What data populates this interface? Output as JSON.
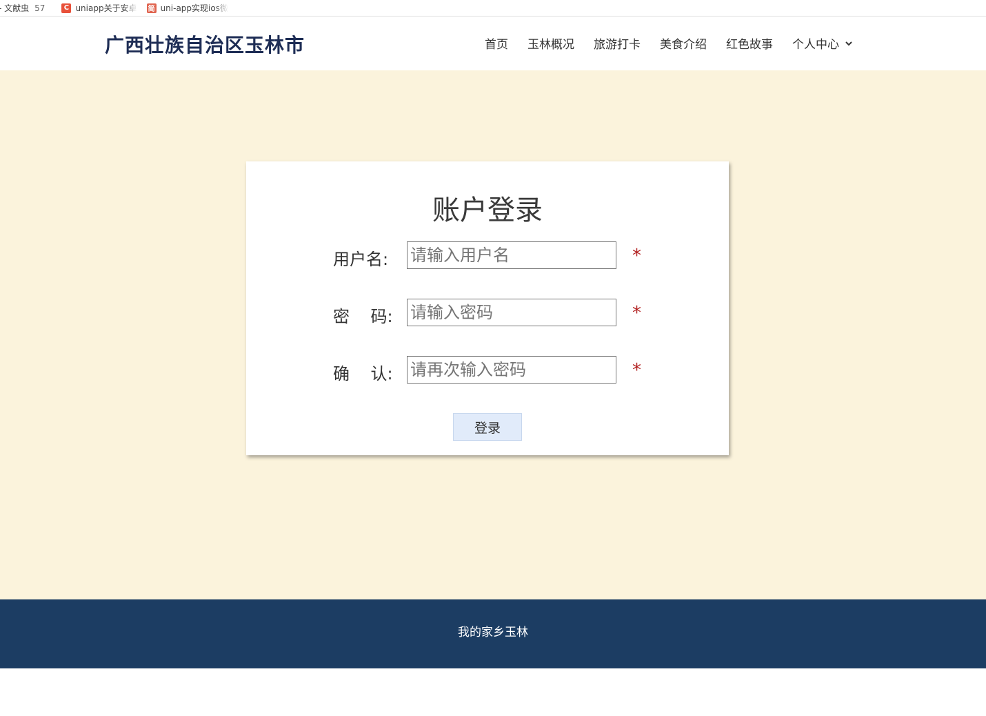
{
  "bookmarks": [
    {
      "label": "- 文献虫",
      "count": "57",
      "icon": "none"
    },
    {
      "label": "uniapp关于安卓",
      "icon": "c-logo-icon",
      "color": "#e8513a"
    },
    {
      "label": "uni-app实现ios微",
      "icon": "jian-logo-icon",
      "color": "#e0644f",
      "glyph": "简"
    }
  ],
  "header": {
    "site_title": "广西壮族自治区玉林市",
    "nav": [
      "首页",
      "玉林概况",
      "旅游打卡",
      "美食介绍",
      "红色故事",
      "个人中心"
    ],
    "dropdown_icon": "chevron-down-icon"
  },
  "login": {
    "title": "账户登录",
    "fields": [
      {
        "label": "用户名:",
        "placeholder": "请输入用户名",
        "required": "*"
      },
      {
        "label": "密    码:",
        "placeholder": "请输入密码",
        "required": "*"
      },
      {
        "label": "确    认:",
        "placeholder": "请再次输入密码",
        "required": "*"
      }
    ],
    "submit_label": "登录"
  },
  "footer": {
    "text": "我的家乡玉林"
  },
  "colors": {
    "title": "#1e2d55",
    "background": "#fbf3dc",
    "footer": "#1c3d63",
    "required": "#b22222",
    "button": "#e1ebfa"
  }
}
